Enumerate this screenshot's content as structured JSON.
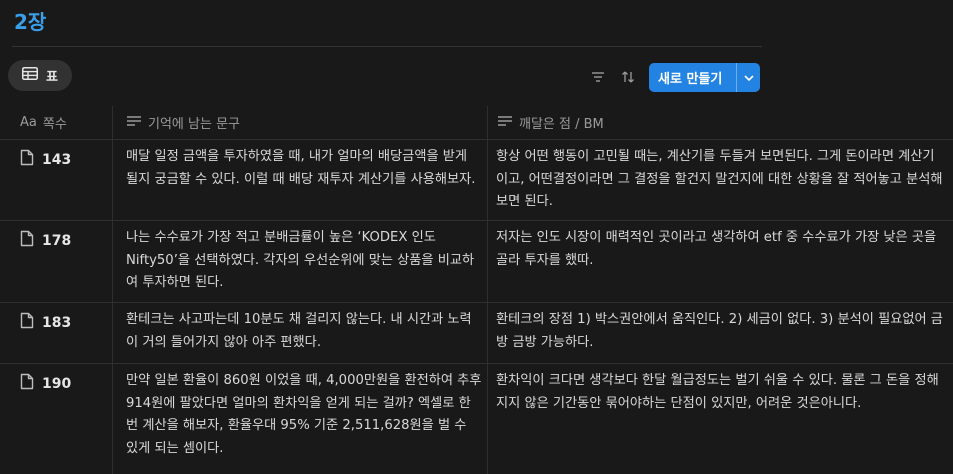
{
  "page": {
    "title": "2장"
  },
  "view": {
    "icon": "table-icon",
    "label": "표"
  },
  "toolbar": {
    "icons": [
      "filter-icon",
      "sort-icon",
      "automation-icon",
      "search-icon",
      "expand-icon",
      "settings-sliders-icon"
    ],
    "new_button_label": "새로 만들기"
  },
  "table": {
    "columns": [
      {
        "icon": "text-type-icon",
        "icon_text": "Aa",
        "label": "쪽수"
      },
      {
        "icon": "text-lines-icon",
        "label": "기억에 남는 문구"
      },
      {
        "icon": "text-lines-icon",
        "label": "깨달은 점 / BM"
      }
    ],
    "rows": [
      {
        "page": "143",
        "quote": "매달 일정 금액을 투자하였을 때, 내가 얼마의 배당금액을 받게 될지 궁금할 수 있다. 이럴 때 배당 재투자 계산기를 사용해보자.",
        "insight": "항상 어떤 행동이 고민될 때는, 계산기를 두들겨 보면된다. 그게 돈이라면 계산기이고, 어떤결정이라면 그 결정을 할건지 말건지에 대한 상황을 잘 적어놓고 분석해보면 된다."
      },
      {
        "page": "178",
        "quote": "나는 수수료가 가장 적고 분배금률이 높은 ‘KODEX 인도 Nifty50’을 선택하였다. 각자의 우선순위에 맞는 상품을 비교하여 투자하면 된다.",
        "insight": "저자는 인도 시장이 매력적인 곳이라고 생각하여 etf 중 수수료가 가장 낮은 곳을 골라 투자를 했따."
      },
      {
        "page": "183",
        "quote": "환테크는 사고파는데 10분도 채 걸리지 않는다. 내 시간과 노력이 거의 들어가지 않아 아주 편했다.",
        "insight": "환테크의 장점 1) 박스권안에서 움직인다. 2) 세금이 없다. 3) 분석이 필요없어 금방 금방 가능하다."
      },
      {
        "page": "190",
        "quote": "만약 일본 환율이 860원 이었을 때, 4,000만원을 환전하여 추후 914원에 팔았다면 얼마의 환차익을 얻게 되는 걸까? 엑셀로 한 번 계산을 해보자, 환율우대 95% 기준 2,511,628원을 벌 수 있게 되는 셈이다.",
        "insight": "환차익이 크다면 생각보다 한달 월급정도는 벌기 쉬울 수 있다. 물론 그 돈을 정해지지 않은 기간동안 묶어야하는 단점이 있지만, 어려운 것은아니다."
      }
    ]
  }
}
